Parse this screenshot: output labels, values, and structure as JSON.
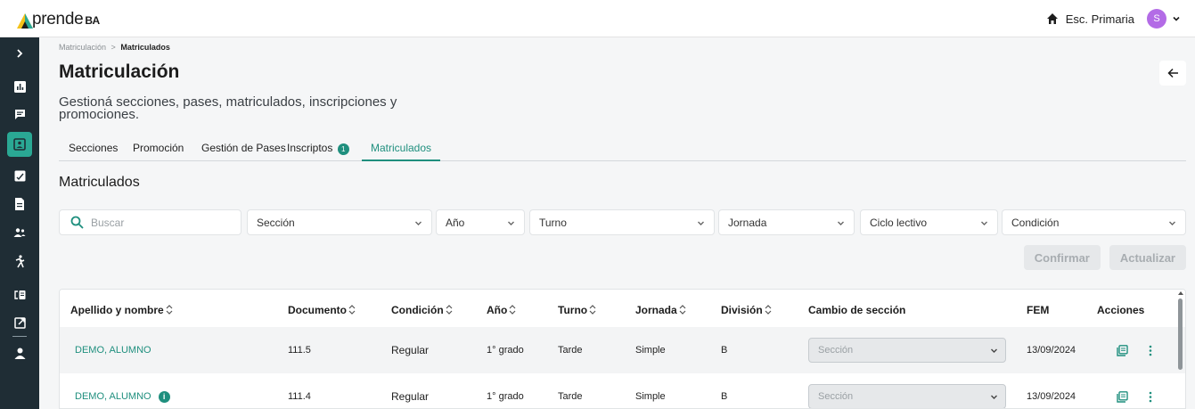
{
  "app": {
    "logo_text": "prende",
    "logo_suffix": "BA",
    "school": "Esc. Primaria",
    "user_initial": "S"
  },
  "colors": {
    "accent": "#1f8f7e",
    "sidebar_bg": "#1f2d35",
    "sidebar_active": "#2aa894",
    "avatar": "#b36be6"
  },
  "sidebar": {
    "icons": [
      "chevron-right-icon",
      "bar-chart-icon",
      "chat-icon",
      "id-card-icon",
      "clipboard-check-icon",
      "document-icon",
      "group-icon",
      "person-walking-icon",
      "transfer-icon",
      "external-link-icon",
      "user-icon"
    ]
  },
  "breadcrumb": {
    "parent": "Matriculación",
    "separator": ">",
    "current": "Matriculados"
  },
  "page": {
    "title": "Matriculación",
    "subtitle": "Gestioná secciones, pases, matriculados, inscripciones y promociones."
  },
  "tabs": [
    {
      "label": "Secciones"
    },
    {
      "label": "Promoción"
    },
    {
      "label": "Gestión de Pases"
    },
    {
      "label": "Inscriptos",
      "badge": "1"
    },
    {
      "label": "Matriculados",
      "active": true
    }
  ],
  "section_title": "Matriculados",
  "filters": {
    "search_placeholder": "Buscar",
    "seccion": "Sección",
    "anio": "Año",
    "turno": "Turno",
    "jornada": "Jornada",
    "ciclo": "Ciclo lectivo",
    "condicion": "Condición"
  },
  "buttons": {
    "confirmar": "Confirmar",
    "actualizar": "Actualizar"
  },
  "table": {
    "headers": {
      "nombre": "Apellido y nombre",
      "documento": "Documento",
      "condicion": "Condición",
      "anio": "Año",
      "turno": "Turno",
      "jornada": "Jornada",
      "division": "División",
      "cambio": "Cambio de sección",
      "fem": "FEM",
      "acciones": "Acciones"
    },
    "rows": [
      {
        "nombre": "DEMO, ALUMNO",
        "documento": "111.5",
        "condicion": "Regular",
        "anio": "1° grado",
        "turno": "Tarde",
        "jornada": "Simple",
        "division": "B",
        "cambio": "Sección",
        "fem": "13/09/2024",
        "info": false
      },
      {
        "nombre": "DEMO, ALUMNO",
        "documento": "111.4",
        "condicion": "Regular",
        "anio": "1° grado",
        "turno": "Tarde",
        "jornada": "Simple",
        "division": "B",
        "cambio": "Sección",
        "fem": "13/09/2024",
        "info": true
      }
    ]
  }
}
